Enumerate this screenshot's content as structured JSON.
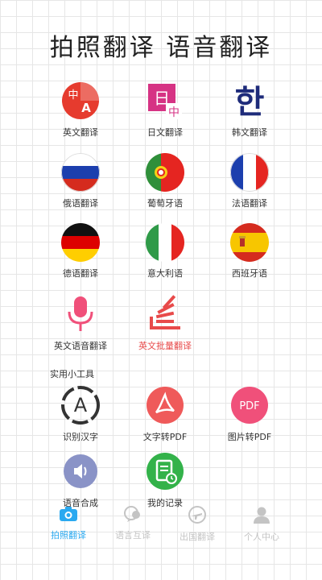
{
  "header": {
    "title": "拍照翻译  语音翻译"
  },
  "grid": {
    "english": "英文翻译",
    "japanese": "日文翻译",
    "korean": "韩文翻译",
    "russian": "俄语翻译",
    "portuguese": "葡萄牙语",
    "french": "法语翻译",
    "german": "德语翻译",
    "italian": "意大利语",
    "spanish": "西班牙语",
    "english_voice": "英文语音翻译",
    "english_batch": "英文批量翻译"
  },
  "icons_text": {
    "zh": "中",
    "a": "A",
    "ri": "日",
    "han": "한",
    "pdf": "PDF"
  },
  "tools": {
    "section_label": "实用小工具",
    "ocr": "识别汉字",
    "text_pdf": "文字转PDF",
    "image_pdf": "图片转PDF",
    "tts": "语音合成",
    "records": "我的记录"
  },
  "tabs": [
    {
      "label": "拍照翻译",
      "icon": "camera-icon",
      "active": true
    },
    {
      "label": "语言互译",
      "icon": "chat-translate-icon",
      "active": false
    },
    {
      "label": "出国翻译",
      "icon": "plane-icon",
      "active": false
    },
    {
      "label": "个人中心",
      "icon": "person-icon",
      "active": false
    }
  ],
  "colors": {
    "accent": "#2aa9f0",
    "highlight": "#e84a4a",
    "tab_inactive": "#c4c4c4"
  }
}
